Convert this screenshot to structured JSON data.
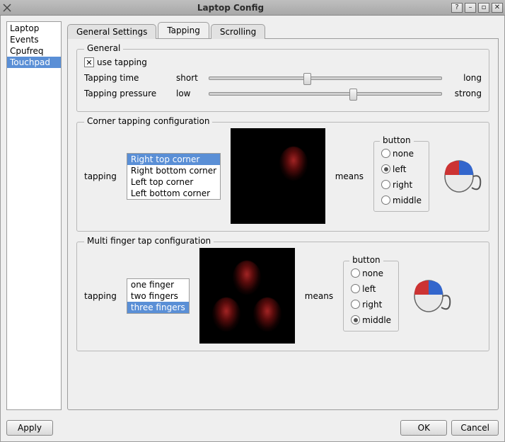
{
  "window": {
    "title": "Laptop Config"
  },
  "sidebar": {
    "items": [
      {
        "label": "Laptop"
      },
      {
        "label": "Events"
      },
      {
        "label": "Cpufreq"
      },
      {
        "label": "Touchpad"
      }
    ],
    "selected_index": 3
  },
  "tabs": {
    "items": [
      {
        "label": "General Settings"
      },
      {
        "label": "Tapping"
      },
      {
        "label": "Scrolling"
      }
    ],
    "active_index": 1
  },
  "general_group": {
    "title": "General",
    "use_tapping_label": "use tapping",
    "use_tapping_checked": true,
    "tapping_time": {
      "label": "Tapping time",
      "left": "short",
      "right": "long",
      "value_percent": 42
    },
    "tapping_pressure": {
      "label": "Tapping pressure",
      "left": "low",
      "right": "strong",
      "value_percent": 62
    }
  },
  "corner_group": {
    "title": "Corner tapping configuration",
    "tapping_label": "tapping",
    "means_label": "means",
    "corner_options": [
      "Right top corner",
      "Right bottom corner",
      "Left top corner",
      "Left bottom corner"
    ],
    "corner_selected_index": 0,
    "button_group": {
      "title": "button",
      "options": [
        "none",
        "left",
        "right",
        "middle"
      ],
      "selected_index": 1
    }
  },
  "multi_group": {
    "title": "Multi finger tap configuration",
    "tapping_label": "tapping",
    "means_label": "means",
    "finger_options": [
      "one finger",
      "two fingers",
      "three fingers"
    ],
    "finger_selected_index": 2,
    "button_group": {
      "title": "button",
      "options": [
        "none",
        "left",
        "right",
        "middle"
      ],
      "selected_index": 3
    }
  },
  "buttons": {
    "apply": "Apply",
    "ok": "OK",
    "cancel": "Cancel"
  }
}
